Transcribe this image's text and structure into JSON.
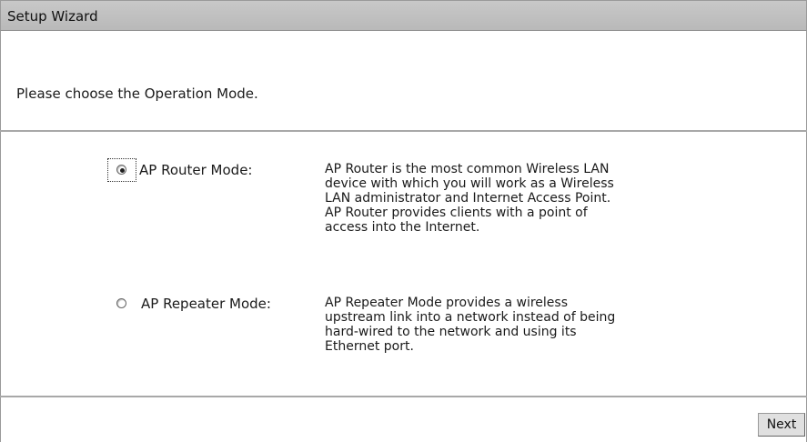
{
  "header": {
    "title": "Setup Wizard"
  },
  "intro": {
    "text": "Please choose the Operation Mode."
  },
  "modes": [
    {
      "label": "AP Router Mode:",
      "selected": true,
      "description": "AP Router is the most common Wireless LAN\ndevice with which you will work as a Wireless\nLAN administrator and Internet Access Point.\nAP Router provides clients with a point of\naccess into the Internet."
    },
    {
      "label": "AP Repeater Mode:",
      "selected": false,
      "description": "AP Repeater Mode provides a wireless\nupstream link into a network instead of being\nhard-wired to the network and using its\nEthernet port."
    }
  ],
  "footer": {
    "next_label": "Next"
  },
  "colors": {
    "header_background": "#c0c0c0",
    "divider": "#a8a8a8",
    "button_background": "#e0e0e0"
  }
}
